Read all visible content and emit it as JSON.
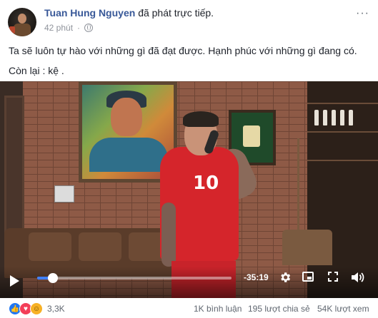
{
  "post": {
    "author": "Tuan Hung Nguyen",
    "action": "đã phát trực tiếp.",
    "time": "42 phút",
    "privacy_icon": "globe-icon",
    "more_label": "···",
    "text_line1": "Ta sẽ luôn tự hào với những gì đã đạt được. Hạnh phúc với những gì đang có.",
    "text_line2": "Còn lại : kệ ."
  },
  "video": {
    "jersey_number": "10",
    "time_remaining": "-35:19",
    "progress": 0.08,
    "icons": [
      "play-icon",
      "gear-icon",
      "picture-in-picture-icon",
      "fullscreen-icon",
      "volume-icon"
    ]
  },
  "stats": {
    "reaction_count": "3,3K",
    "reactions": [
      "like",
      "love",
      "haha"
    ],
    "comments": "1K bình luận",
    "shares": "195 lượt chia sẻ",
    "views": "54K lượt xem"
  },
  "colors": {
    "author_link": "#385898",
    "meta_gray": "#90949c",
    "progress_blue": "#4080ff",
    "jersey_red": "#d5252b"
  }
}
